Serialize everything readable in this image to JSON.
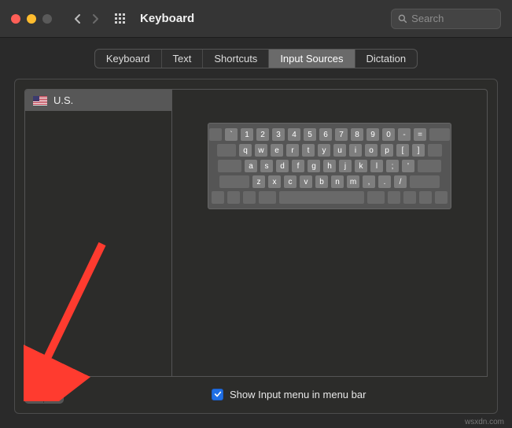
{
  "window": {
    "title": "Keyboard"
  },
  "search": {
    "placeholder": "Search",
    "value": ""
  },
  "tabs": [
    {
      "label": "Keyboard",
      "selected": false
    },
    {
      "label": "Text",
      "selected": false
    },
    {
      "label": "Shortcuts",
      "selected": false
    },
    {
      "label": "Input Sources",
      "selected": true
    },
    {
      "label": "Dictation",
      "selected": false
    }
  ],
  "sources": [
    {
      "flag": "us",
      "name": "U.S."
    }
  ],
  "keyboard_rows": [
    [
      "`",
      "1",
      "2",
      "3",
      "4",
      "5",
      "6",
      "7",
      "8",
      "9",
      "0",
      "-",
      "="
    ],
    [
      "q",
      "w",
      "e",
      "r",
      "t",
      "y",
      "u",
      "i",
      "o",
      "p",
      "[",
      "]"
    ],
    [
      "a",
      "s",
      "d",
      "f",
      "g",
      "h",
      "j",
      "k",
      "l",
      ";",
      "'"
    ],
    [
      "z",
      "x",
      "c",
      "v",
      "b",
      "n",
      "m",
      ",",
      ".",
      "/"
    ]
  ],
  "buttons": {
    "add": "+",
    "remove": "−"
  },
  "checkbox": {
    "show_input_menu_checked": true,
    "show_input_menu_label": "Show Input menu in menu bar"
  },
  "watermark": "wsxdn.com"
}
